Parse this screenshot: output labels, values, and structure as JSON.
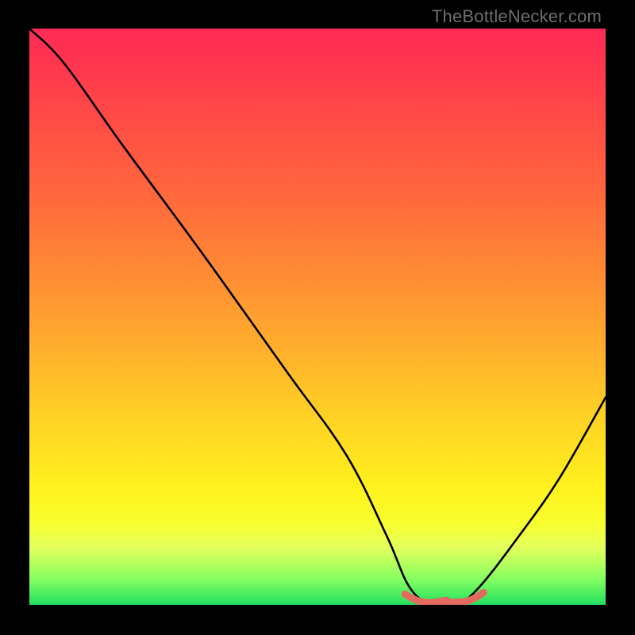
{
  "watermark": "TheBottleNecker.com",
  "chart_data": {
    "type": "line",
    "title": "",
    "xlabel": "",
    "ylabel": "",
    "xlim": [
      0,
      100
    ],
    "ylim": [
      0,
      100
    ],
    "series": [
      {
        "name": "bottleneck-curve",
        "x": [
          0,
          6,
          16,
          30,
          45,
          55,
          62,
          66,
          70,
          74,
          78,
          85,
          92,
          100
        ],
        "y": [
          100,
          94,
          80,
          61,
          40,
          26,
          12,
          3,
          0,
          0,
          3,
          12,
          22,
          36
        ]
      }
    ],
    "flat_region": {
      "x_start": 66,
      "x_end": 78
    },
    "background": {
      "type": "vertical-gradient",
      "stops": [
        {
          "pos": 0.0,
          "color": "#ff2a55"
        },
        {
          "pos": 0.3,
          "color": "#ff6a3c"
        },
        {
          "pos": 0.68,
          "color": "#ffd324"
        },
        {
          "pos": 0.86,
          "color": "#f8ff30"
        },
        {
          "pos": 0.955,
          "color": "#86ff60"
        },
        {
          "pos": 1.0,
          "color": "#22e060"
        }
      ]
    }
  }
}
